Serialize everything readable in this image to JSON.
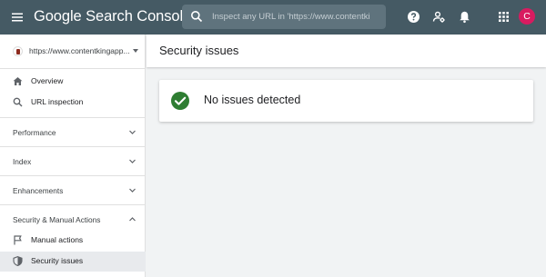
{
  "app": {
    "title": "Google Search Console"
  },
  "search": {
    "placeholder": "Inspect any URL in 'https://www.contentki"
  },
  "avatar": {
    "initial": "C",
    "color": "#d81b60"
  },
  "property": {
    "url": "https://www.contentkingapp..."
  },
  "sidebar": {
    "items": [
      {
        "label": "Overview",
        "icon": "home-icon"
      },
      {
        "label": "URL inspection",
        "icon": "search-icon"
      }
    ],
    "sections": [
      {
        "label": "Performance",
        "icon": "chevron-down-icon"
      },
      {
        "label": "Index",
        "icon": "chevron-down-icon"
      },
      {
        "label": "Enhancements",
        "icon": "chevron-down-icon"
      },
      {
        "label": "Security & Manual Actions",
        "icon": "chevron-up-icon"
      }
    ],
    "sub_items": [
      {
        "label": "Manual actions",
        "icon": "flag-icon"
      },
      {
        "label": "Security issues",
        "icon": "shield-icon",
        "active": true
      }
    ]
  },
  "main": {
    "title": "Security issues",
    "status_message": "No issues detected",
    "status_color": "#2e7d32"
  },
  "colors": {
    "topbar": "#455a64",
    "searchbox": "#5f737d"
  }
}
